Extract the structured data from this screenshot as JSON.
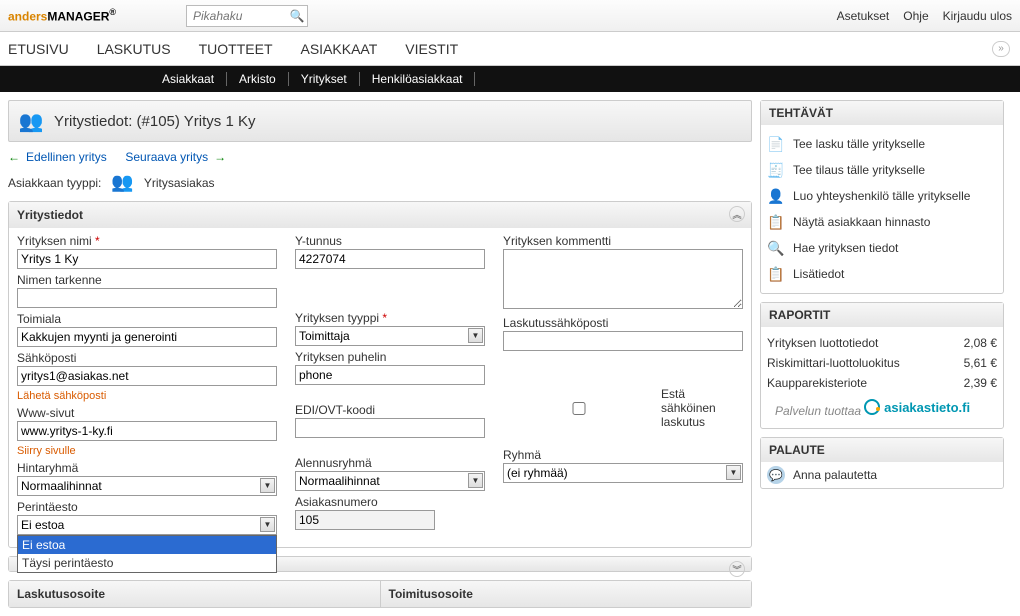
{
  "header": {
    "logo1": "anders",
    "logo2": "MANAGER",
    "search_placeholder": "Pikahaku",
    "links": [
      "Asetukset",
      "Ohje",
      "Kirjaudu ulos"
    ]
  },
  "nav": [
    "ETUSIVU",
    "LASKUTUS",
    "TUOTTEET",
    "ASIAKKAAT",
    "VIESTIT"
  ],
  "subnav": [
    "Asiakkaat",
    "Arkisto",
    "Yritykset",
    "Henkilöasiakkaat"
  ],
  "page": {
    "title": "Yritystiedot: (#105) Yritys 1 Ky",
    "prev": "Edellinen yritys",
    "next": "Seuraava yritys",
    "type_label": "Asiakkaan tyyppi:",
    "type_value": "Yritysasiakas",
    "section_title": "Yritystiedot"
  },
  "form": {
    "name_label": "Yrityksen nimi",
    "name_value": "Yritys 1 Ky",
    "name_ext_label": "Nimen tarkenne",
    "name_ext_value": "",
    "industry_label": "Toimiala",
    "industry_value": "Kakkujen myynti ja generointi",
    "email_label": "Sähköposti",
    "email_value": "yritys1@asiakas.net",
    "email_link": "Lähetä sähköposti",
    "www_label": "Www-sivut",
    "www_value": "www.yritys-1-ky.fi",
    "www_link": "Siirry sivulle",
    "pricegroup_label": "Hintaryhmä",
    "pricegroup_value": "Normaalihinnat",
    "collect_label": "Perintäesto",
    "collect_value": "Ei estoa",
    "collect_options": [
      "Ei estoa",
      "Täysi perintäesto"
    ],
    "ytunnus_label": "Y-tunnus",
    "ytunnus_value": "4227074",
    "ctype_label": "Yrityksen tyyppi",
    "ctype_value": "Toimittaja",
    "phone_label": "Yrityksen puhelin",
    "phone_value": "phone",
    "edi_label": "EDI/OVT-koodi",
    "edi_value": "",
    "discount_label": "Alennusryhmä",
    "discount_value": "Normaalihinnat",
    "custno_label": "Asiakasnumero",
    "custno_value": "105",
    "comment_label": "Yrityksen kommentti",
    "invemail_label": "Laskutussähköposti",
    "invemail_value": "",
    "einv_label": "Estä sähköinen laskutus",
    "group_label": "Ryhmä",
    "group_value": "(ei ryhmää)"
  },
  "bottom": {
    "billing": "Laskutusosoite",
    "delivery": "Toimitusosoite"
  },
  "side": {
    "tasks_title": "TEHTÄVÄT",
    "tasks": [
      "Tee lasku tälle yritykselle",
      "Tee tilaus tälle yritykselle",
      "Luo yhteyshenkilö tälle yritykselle",
      "Näytä asiakkaan hinnasto",
      "Hae yrityksen tiedot",
      "Lisätiedot"
    ],
    "reports_title": "RAPORTIT",
    "reports": [
      {
        "name": "Yrityksen luottotiedot",
        "price": "2,08 €"
      },
      {
        "name": "Riskimittari-luottoluokitus",
        "price": "5,61 €"
      },
      {
        "name": "Kaupparekisteriote",
        "price": "2,39 €"
      }
    ],
    "service_by": "Palvelun tuottaa",
    "service_name": "asiakastieto.fi",
    "feedback_title": "PALAUTE",
    "feedback_link": "Anna palautetta"
  }
}
